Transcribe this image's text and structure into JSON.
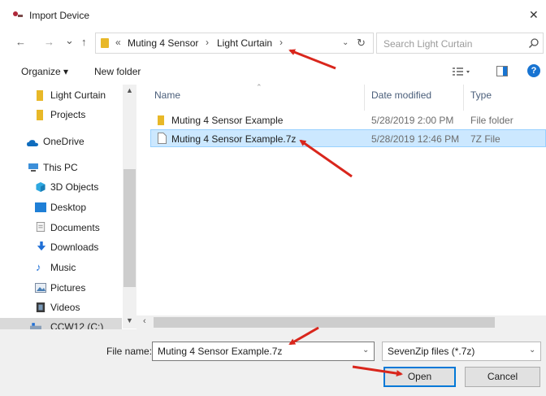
{
  "window": {
    "title": "Import Device",
    "close_glyph": "✕"
  },
  "nav": {
    "back_glyph": "←",
    "forward_glyph": "→",
    "recent_glyph": "⌄",
    "up_glyph": "↑",
    "overflow_glyph": "«",
    "breadcrumb": [
      "Muting 4 Sensor",
      "Light Curtain"
    ],
    "sep_glyph": "›",
    "refresh_glyph": "↻",
    "search_placeholder": "Search Light Curtain"
  },
  "toolbar": {
    "organize": "Organize ▾",
    "new_folder": "New folder",
    "help": "?"
  },
  "sidebar": {
    "items": [
      {
        "label": "Light Curtain",
        "icon": "folder-icon"
      },
      {
        "label": "Projects",
        "icon": "folder-icon"
      },
      {
        "label": "OneDrive",
        "icon": "cloud-icon"
      },
      {
        "label": "This PC",
        "icon": "computer-icon"
      },
      {
        "label": "3D Objects",
        "icon": "cube-icon"
      },
      {
        "label": "Desktop",
        "icon": "desktop-icon"
      },
      {
        "label": "Documents",
        "icon": "document-icon"
      },
      {
        "label": "Downloads",
        "icon": "download-icon"
      },
      {
        "label": "Music",
        "icon": "music-icon"
      },
      {
        "label": "Pictures",
        "icon": "pictures-icon"
      },
      {
        "label": "Videos",
        "icon": "video-icon"
      },
      {
        "label": "CCW12 (C:)",
        "icon": "drive-icon"
      }
    ]
  },
  "columns": {
    "name": "Name",
    "date": "Date modified",
    "type": "Type"
  },
  "files": [
    {
      "name": "Muting 4 Sensor Example",
      "date": "5/28/2019 2:00 PM",
      "type": "File folder",
      "icon": "folder-icon",
      "selected": false
    },
    {
      "name": "Muting 4 Sensor Example.7z",
      "date": "5/28/2019 12:46 PM",
      "type": "7Z File",
      "icon": "file-icon",
      "selected": true
    }
  ],
  "footer": {
    "file_name_label": "File name:",
    "file_name_value": "Muting 4 Sensor Example.7z",
    "filter_value": "SevenZip files (*.7z)",
    "open_label": "Open",
    "cancel_label": "Cancel"
  },
  "colors": {
    "accent": "#0078d7",
    "selection": "#cce8ff",
    "annotation_arrow": "#d9261c",
    "folder": "#e8b828"
  }
}
